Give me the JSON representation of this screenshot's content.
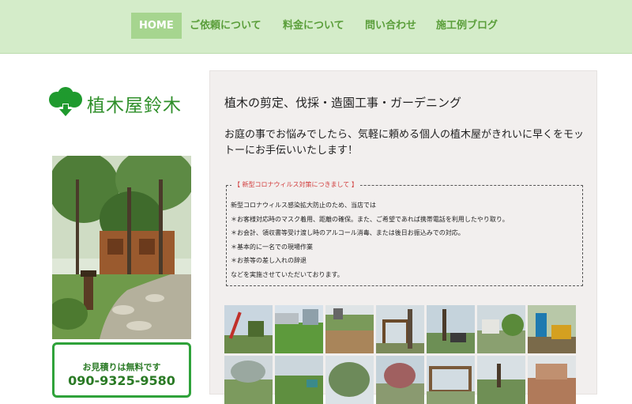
{
  "nav": {
    "items": [
      {
        "label": "HOME",
        "active": true
      },
      {
        "label": "ご依頼について",
        "active": false
      },
      {
        "label": "料金について",
        "active": false
      },
      {
        "label": "問い合わせ",
        "active": false
      },
      {
        "label": "施工例ブログ",
        "active": false
      }
    ]
  },
  "sidebar": {
    "logo_text": "植木屋鈴木",
    "estimate": {
      "note": "お見積りは無料です",
      "phone": "090-9325-9580"
    }
  },
  "main": {
    "title": "植木の剪定、伐採・造園工事・ガーデニング",
    "intro": "お庭の事でお悩みでしたら、気軽に頼める個人の植木屋がきれいに早くをモットーにお手伝いいたします！",
    "notice": {
      "heading": "【 新型コロナウィルス対策につきまして 】",
      "lines": [
        "新型コロナウィルス感染拡大防止のため、当店では",
        "＊お客様対応時のマスク着用、距離の確保。また、ご希望であれば携帯電話を利用したやり取り。",
        "＊お会計、領収書等受け渡し時のアルコール消毒、または後日お振込みでの対応。",
        "＊基本的に一名での現場作業",
        "＊お茶等の差し入れの辞退",
        "などを実施させていただいております。"
      ]
    }
  },
  "colors": {
    "nav_bg": "#d4ecc9",
    "nav_active": "#a6d58f",
    "brand_green": "#2f8f2a",
    "notice_red": "#d13a3a"
  }
}
